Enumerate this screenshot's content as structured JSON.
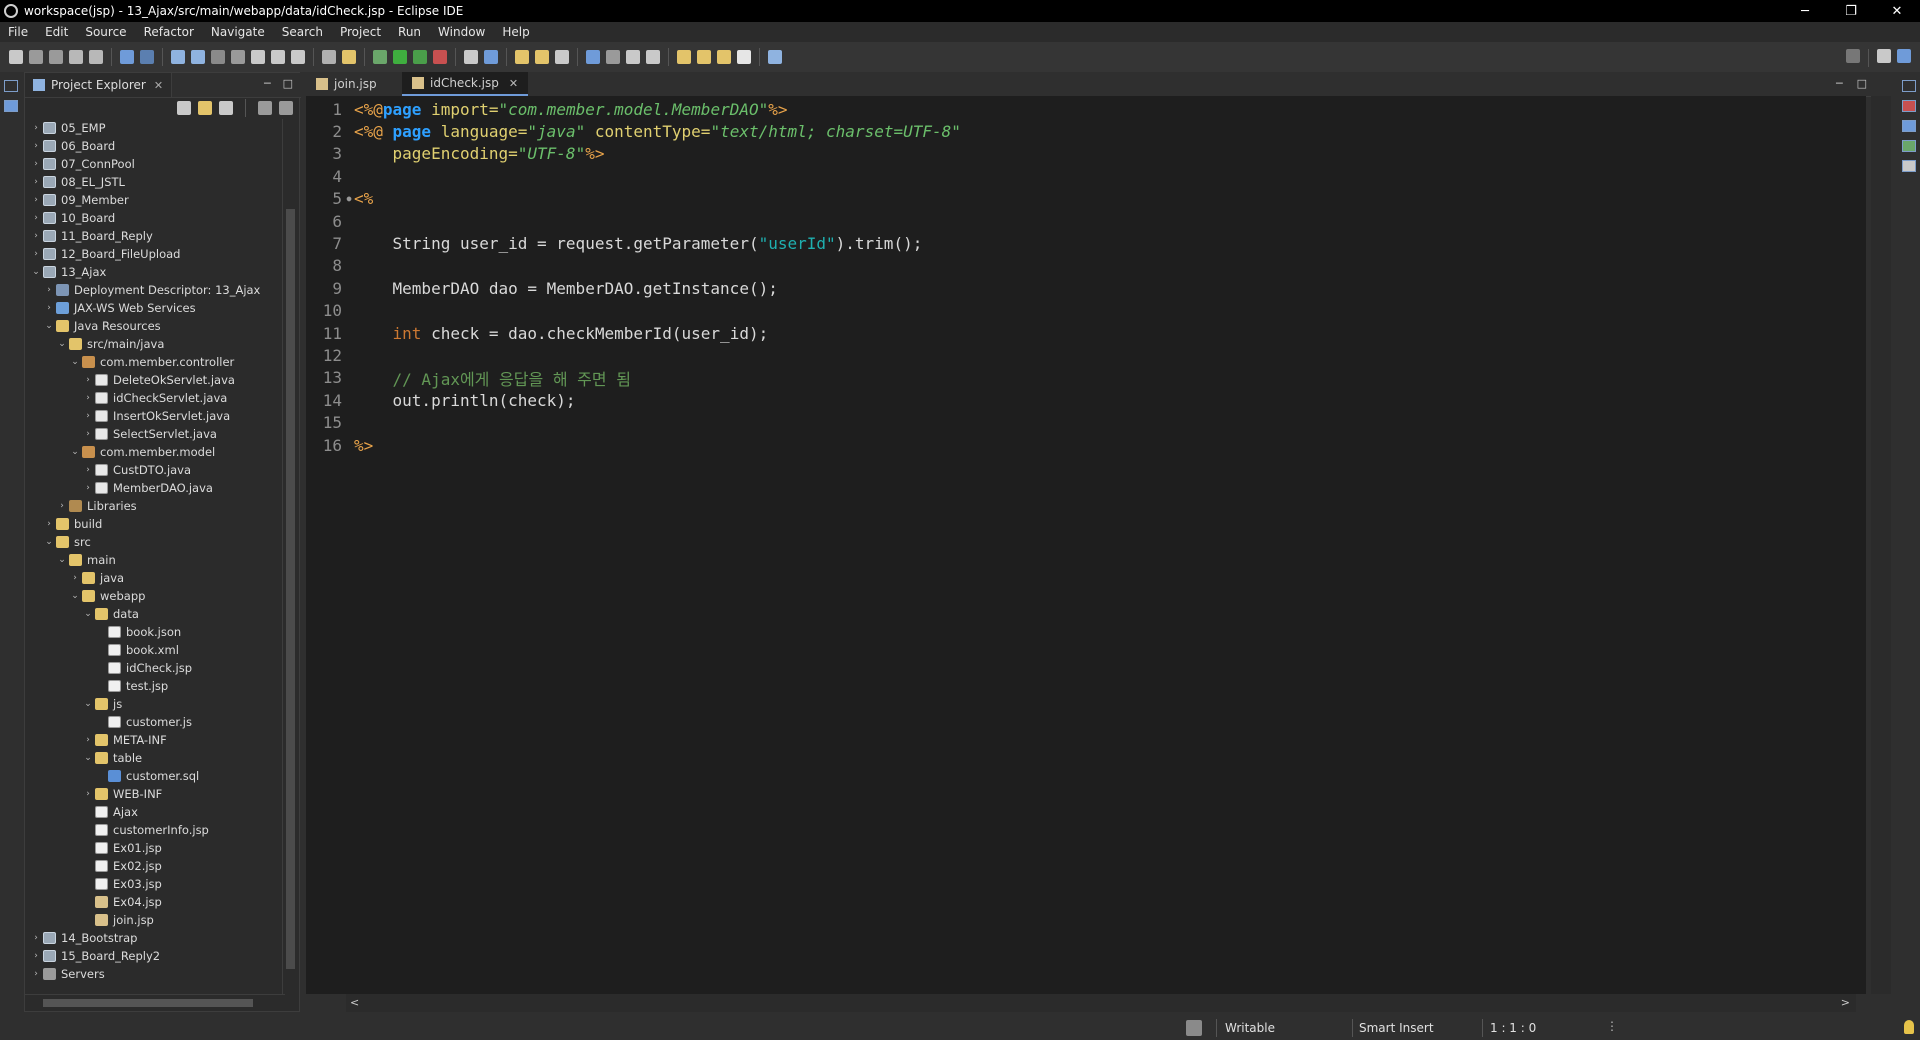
{
  "window": {
    "title": "workspace(jsp) - 13_Ajax/src/main/webapp/data/idCheck.jsp - Eclipse IDE",
    "controls": {
      "minimize": "─",
      "restore": "❐",
      "close": "✕"
    }
  },
  "menu": [
    "File",
    "Edit",
    "Source",
    "Refactor",
    "Navigate",
    "Search",
    "Project",
    "Run",
    "Window",
    "Help"
  ],
  "explorer": {
    "tab_label": "Project Explorer",
    "tree": [
      {
        "label": "05_EMP",
        "depth": 0,
        "twisty": ">",
        "icon": "project-icon"
      },
      {
        "label": "06_Board",
        "depth": 0,
        "twisty": ">",
        "icon": "project-icon"
      },
      {
        "label": "07_ConnPool",
        "depth": 0,
        "twisty": ">",
        "icon": "project-icon"
      },
      {
        "label": "08_EL_JSTL",
        "depth": 0,
        "twisty": ">",
        "icon": "project-icon"
      },
      {
        "label": "09_Member",
        "depth": 0,
        "twisty": ">",
        "icon": "project-icon"
      },
      {
        "label": "10_Board",
        "depth": 0,
        "twisty": ">",
        "icon": "project-icon"
      },
      {
        "label": "11_Board_Reply",
        "depth": 0,
        "twisty": ">",
        "icon": "project-icon"
      },
      {
        "label": "12_Board_FileUpload",
        "depth": 0,
        "twisty": ">",
        "icon": "project-icon"
      },
      {
        "label": "13_Ajax",
        "depth": 0,
        "twisty": "v",
        "icon": "project-icon"
      },
      {
        "label": "Deployment Descriptor: 13_Ajax",
        "depth": 1,
        "twisty": ">",
        "icon": "descriptor-icon"
      },
      {
        "label": "JAX-WS Web Services",
        "depth": 1,
        "twisty": ">",
        "icon": "web-services-icon"
      },
      {
        "label": "Java Resources",
        "depth": 1,
        "twisty": "v",
        "icon": "java-resources-icon"
      },
      {
        "label": "src/main/java",
        "depth": 2,
        "twisty": "v",
        "icon": "source-folder-icon"
      },
      {
        "label": "com.member.controller",
        "depth": 3,
        "twisty": "v",
        "icon": "package-icon"
      },
      {
        "label": "DeleteOkServlet.java",
        "depth": 4,
        "twisty": ">",
        "icon": "java-file-icon"
      },
      {
        "label": "idCheckServlet.java",
        "depth": 4,
        "twisty": ">",
        "icon": "java-file-icon"
      },
      {
        "label": "InsertOkServlet.java",
        "depth": 4,
        "twisty": ">",
        "icon": "java-file-icon"
      },
      {
        "label": "SelectServlet.java",
        "depth": 4,
        "twisty": ">",
        "icon": "java-file-icon"
      },
      {
        "label": "com.member.model",
        "depth": 3,
        "twisty": "v",
        "icon": "package-icon"
      },
      {
        "label": "CustDTO.java",
        "depth": 4,
        "twisty": ">",
        "icon": "java-file-icon"
      },
      {
        "label": "MemberDAO.java",
        "depth": 4,
        "twisty": ">",
        "icon": "java-file-icon"
      },
      {
        "label": "Libraries",
        "depth": 2,
        "twisty": ">",
        "icon": "libraries-icon"
      },
      {
        "label": "build",
        "depth": 1,
        "twisty": ">",
        "icon": "folder-icon"
      },
      {
        "label": "src",
        "depth": 1,
        "twisty": "v",
        "icon": "folder-icon"
      },
      {
        "label": "main",
        "depth": 2,
        "twisty": "v",
        "icon": "folder-icon"
      },
      {
        "label": "java",
        "depth": 3,
        "twisty": ">",
        "icon": "folder-icon"
      },
      {
        "label": "webapp",
        "depth": 3,
        "twisty": "v",
        "icon": "folder-icon"
      },
      {
        "label": "data",
        "depth": 4,
        "twisty": "v",
        "icon": "folder-icon"
      },
      {
        "label": "book.json",
        "depth": 5,
        "twisty": "",
        "icon": "file-icon"
      },
      {
        "label": "book.xml",
        "depth": 5,
        "twisty": "",
        "icon": "xml-file-icon"
      },
      {
        "label": "idCheck.jsp",
        "depth": 5,
        "twisty": "",
        "icon": "file-icon"
      },
      {
        "label": "test.jsp",
        "depth": 5,
        "twisty": "",
        "icon": "file-icon"
      },
      {
        "label": "js",
        "depth": 4,
        "twisty": "v",
        "icon": "folder-icon"
      },
      {
        "label": "customer.js",
        "depth": 5,
        "twisty": "",
        "icon": "file-icon"
      },
      {
        "label": "META-INF",
        "depth": 4,
        "twisty": ">",
        "icon": "folder-icon"
      },
      {
        "label": "table",
        "depth": 4,
        "twisty": "v",
        "icon": "folder-icon"
      },
      {
        "label": "customer.sql",
        "depth": 5,
        "twisty": "",
        "icon": "sql-file-icon"
      },
      {
        "label": "WEB-INF",
        "depth": 4,
        "twisty": ">",
        "icon": "folder-icon"
      },
      {
        "label": "Ajax",
        "depth": 4,
        "twisty": "",
        "icon": "file-icon"
      },
      {
        "label": "customerInfo.jsp",
        "depth": 4,
        "twisty": "",
        "icon": "file-icon"
      },
      {
        "label": "Ex01.jsp",
        "depth": 4,
        "twisty": "",
        "icon": "file-icon"
      },
      {
        "label": "Ex02.jsp",
        "depth": 4,
        "twisty": "",
        "icon": "file-icon"
      },
      {
        "label": "Ex03.jsp",
        "depth": 4,
        "twisty": "",
        "icon": "file-icon"
      },
      {
        "label": "Ex04.jsp",
        "depth": 4,
        "twisty": "",
        "icon": "jsp-file-icon"
      },
      {
        "label": "join.jsp",
        "depth": 4,
        "twisty": "",
        "icon": "jsp-file-icon"
      },
      {
        "label": "14_Bootstrap",
        "depth": 0,
        "twisty": ">",
        "icon": "project-icon"
      },
      {
        "label": "15_Board_Reply2",
        "depth": 0,
        "twisty": ">",
        "icon": "project-icon"
      },
      {
        "label": "Servers",
        "depth": 0,
        "twisty": ">",
        "icon": "server-icon"
      }
    ]
  },
  "editor": {
    "tabs": [
      {
        "label": "join.jsp",
        "active": false
      },
      {
        "label": "idCheck.jsp",
        "active": true
      }
    ],
    "lines": [
      {
        "n": "1",
        "fold": "",
        "tokens": [
          [
            "tag",
            "<%@"
          ],
          [
            "kw",
            "page"
          ],
          [
            "plain",
            " "
          ],
          [
            "attr",
            "import="
          ],
          [
            "str",
            "\"com.member.model.MemberDAO\""
          ],
          [
            "tag",
            "%>"
          ]
        ]
      },
      {
        "n": "2",
        "fold": "",
        "tokens": [
          [
            "tag",
            "<%@ "
          ],
          [
            "kw",
            "page"
          ],
          [
            "plain",
            " "
          ],
          [
            "attr",
            "language="
          ],
          [
            "str",
            "\"java\""
          ],
          [
            "plain",
            " "
          ],
          [
            "attr",
            "contentType="
          ],
          [
            "str",
            "\"text/html; charset=UTF-8\""
          ]
        ]
      },
      {
        "n": "3",
        "fold": "",
        "tokens": [
          [
            "plain",
            "    "
          ],
          [
            "attr",
            "pageEncoding="
          ],
          [
            "str",
            "\"UTF-8\""
          ],
          [
            "tag",
            "%>"
          ]
        ]
      },
      {
        "n": "4",
        "fold": "",
        "tokens": []
      },
      {
        "n": "5",
        "fold": "●",
        "tokens": [
          [
            "tag",
            "<%"
          ]
        ]
      },
      {
        "n": "6",
        "fold": "",
        "tokens": []
      },
      {
        "n": "7",
        "fold": "",
        "tokens": [
          [
            "plain",
            "    String user_id = request.getParameter("
          ],
          [
            "str2",
            "\"userId\""
          ],
          [
            "plain",
            ").trim();"
          ]
        ]
      },
      {
        "n": "8",
        "fold": "",
        "tokens": []
      },
      {
        "n": "9",
        "fold": "",
        "tokens": [
          [
            "plain",
            "    MemberDAO dao = MemberDAO.getInstance();"
          ]
        ]
      },
      {
        "n": "10",
        "fold": "",
        "tokens": []
      },
      {
        "n": "11",
        "fold": "",
        "tokens": [
          [
            "plain",
            "    "
          ],
          [
            "kw2",
            "int"
          ],
          [
            "plain",
            " check = dao.checkMemberId(user_id);"
          ]
        ]
      },
      {
        "n": "12",
        "fold": "",
        "tokens": []
      },
      {
        "n": "13",
        "fold": "",
        "tokens": [
          [
            "cmt",
            "    // Ajax에게 응답을 해 주면 됨"
          ]
        ]
      },
      {
        "n": "14",
        "fold": "",
        "tokens": [
          [
            "plain",
            "    out.println(check);"
          ]
        ]
      },
      {
        "n": "15",
        "fold": "",
        "tokens": []
      },
      {
        "n": "16",
        "fold": "",
        "tokens": [
          [
            "tag",
            "%>"
          ]
        ]
      }
    ]
  },
  "status": {
    "writable": "Writable",
    "insert_mode": "Smart Insert",
    "position": "1 : 1 : 0"
  },
  "colors": {
    "background": "#2f2f2f",
    "editor_background": "#1e1e1e",
    "keyword": "#2ea0ff",
    "string": "#6bbf6b",
    "comment": "#629755"
  }
}
